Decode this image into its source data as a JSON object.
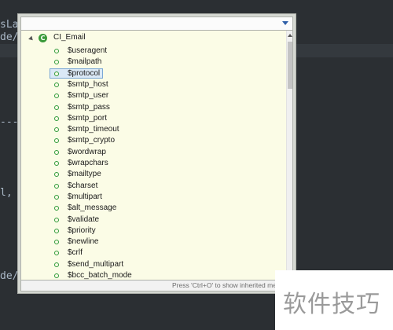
{
  "editor": {
    "fragments": [
      "sLa",
      "de/",
      "----",
      "l,",
      "de/"
    ]
  },
  "popup": {
    "root": {
      "icon_letter": "C",
      "label": "CI_Email"
    },
    "items": [
      {
        "label": "$useragent"
      },
      {
        "label": "$mailpath"
      },
      {
        "label": "$protocol",
        "selected": true
      },
      {
        "label": "$smtp_host"
      },
      {
        "label": "$smtp_user"
      },
      {
        "label": "$smtp_pass"
      },
      {
        "label": "$smtp_port"
      },
      {
        "label": "$smtp_timeout"
      },
      {
        "label": "$smtp_crypto"
      },
      {
        "label": "$wordwrap"
      },
      {
        "label": "$wrapchars"
      },
      {
        "label": "$mailtype"
      },
      {
        "label": "$charset"
      },
      {
        "label": "$multipart"
      },
      {
        "label": "$alt_message"
      },
      {
        "label": "$validate"
      },
      {
        "label": "$priority"
      },
      {
        "label": "$newline"
      },
      {
        "label": "$crlf"
      },
      {
        "label": "$send_multipart"
      },
      {
        "label": "$bcc_batch_mode"
      }
    ],
    "status_text": "Press 'Ctrl+O' to show inherited me"
  },
  "watermark": {
    "text": "软件技巧"
  },
  "colors": {
    "editor_bg": "#2b2f33",
    "list_bg": "#fbfce6",
    "class_icon": "#3a9a3a",
    "field_icon": "#2e9a3a",
    "selection_border": "#7aa7d6"
  }
}
